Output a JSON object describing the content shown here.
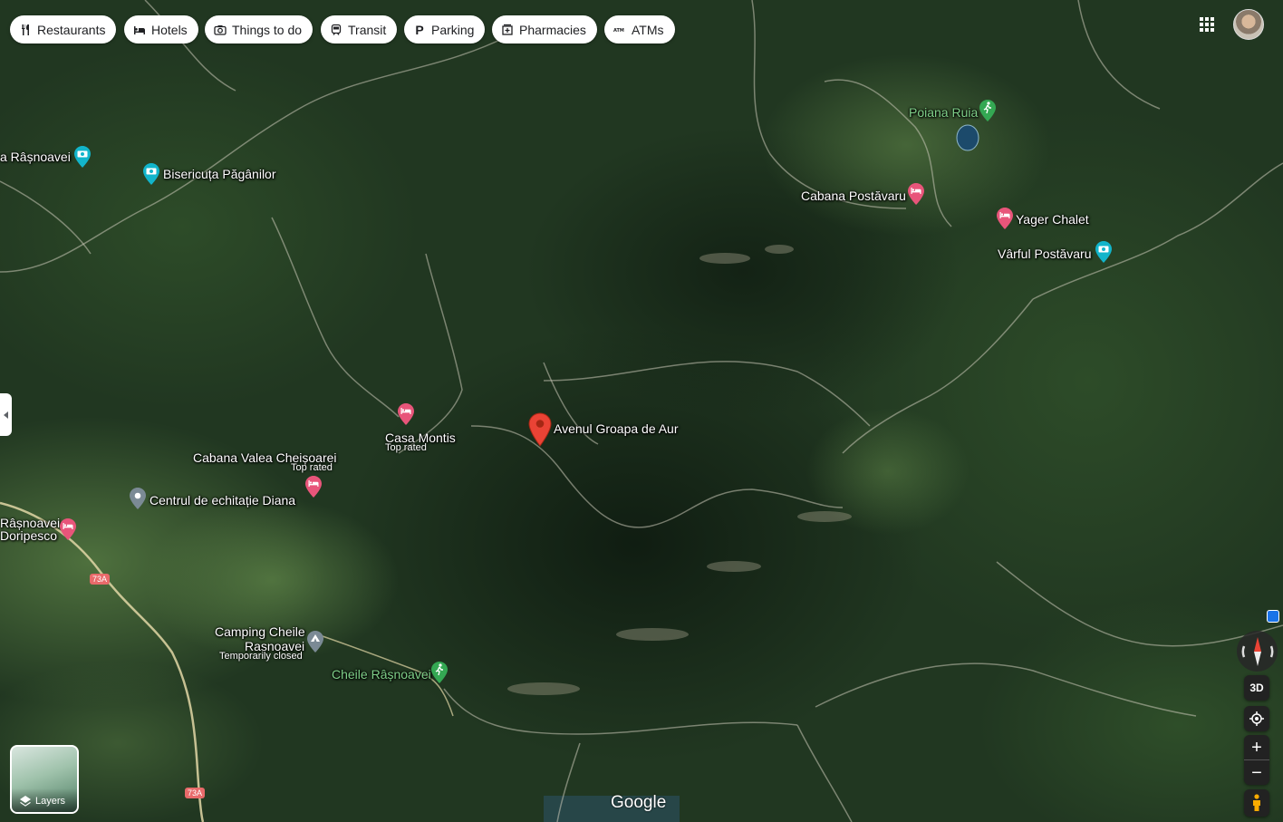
{
  "filters": [
    {
      "label": "Restaurants",
      "icon": "restaurant-icon"
    },
    {
      "label": "Hotels",
      "icon": "bed-icon"
    },
    {
      "label": "Things to do",
      "icon": "camera-icon"
    },
    {
      "label": "Transit",
      "icon": "train-icon"
    },
    {
      "label": "Parking",
      "icon": "parking-icon"
    },
    {
      "label": "Pharmacies",
      "icon": "pharmacy-icon"
    },
    {
      "label": "ATMs",
      "icon": "atm-icon"
    }
  ],
  "places": {
    "selected": {
      "name": "Avenul Groapa de Aur"
    },
    "poiana_ruia": "Poiana Ruia",
    "cabana_postavaru": "Cabana Postăvaru",
    "yager_chalet": "Yager Chalet",
    "varful_postavaru": "Vârful Postăvaru",
    "bisericuta": "Bisericuța Păgânilor",
    "cetatea_rasnoavei": "a Râșnoavei",
    "casa_montis": "Casa Montis",
    "casa_montis_sub": "Top rated",
    "cabana_valea": "Cabana Valea Cheișoarei",
    "cabana_valea_sub": "Top rated",
    "centrul": "Centrul de echitație Diana",
    "rasnoavei_left_1": "Râșnoavei",
    "rasnoavei_left_2": "Doripesco",
    "camping_1": "Camping Cheile",
    "camping_2": "Rasnoavei",
    "camping_sub": "Temporarily closed",
    "cheile": "Cheile Râșnoavei"
  },
  "roads": [
    "73A",
    "73A"
  ],
  "controls": {
    "layers_label": "Layers",
    "three_d_label": "3D",
    "zoom_in": "+",
    "zoom_out": "−"
  },
  "branding": {
    "logo": "Google"
  },
  "colors": {
    "forest": "#1f3320",
    "meadow": "#3d6b2e",
    "selected_pin": "#ea4335",
    "hotel_pin": "#e8557a",
    "attraction_pin": "#12b5cb",
    "park_pin": "#34a853"
  }
}
